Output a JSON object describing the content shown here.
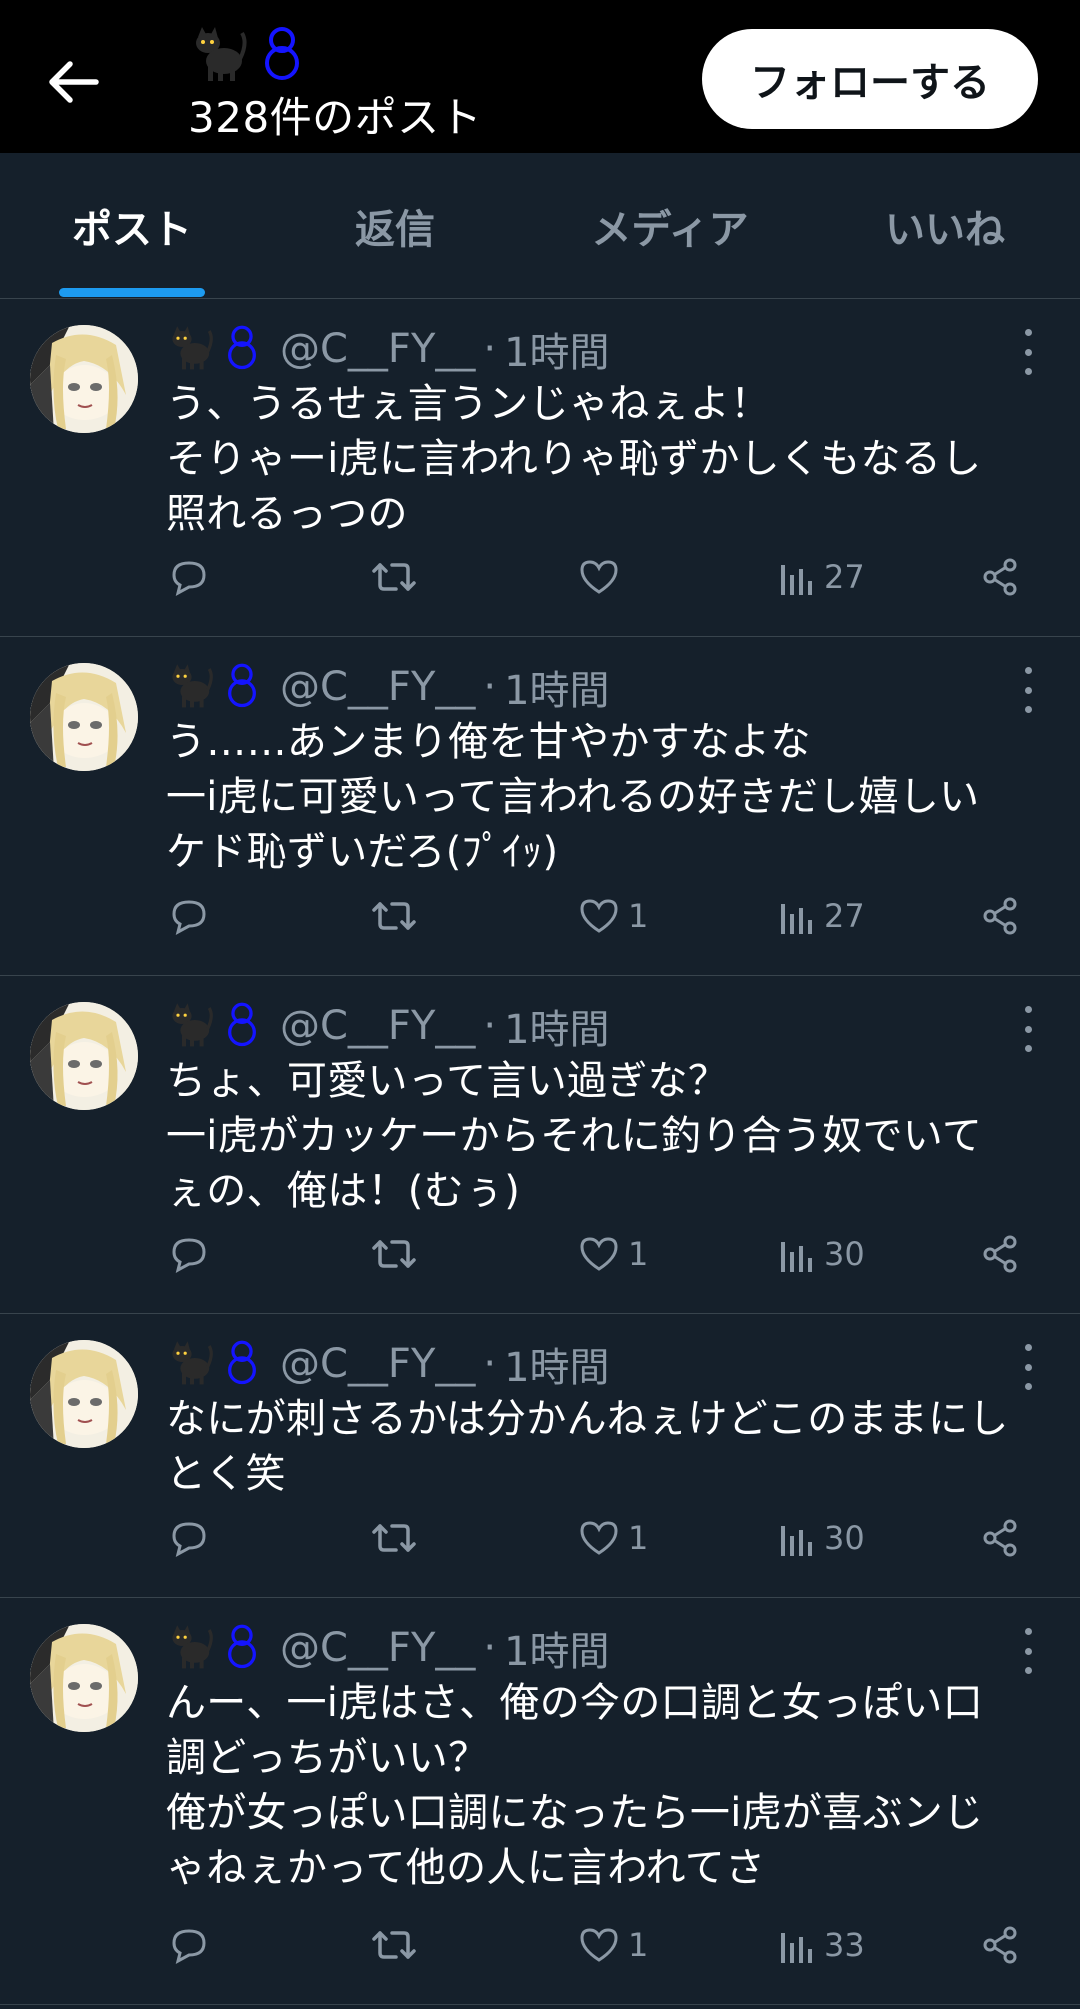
{
  "header": {
    "post_count": "328件のポスト",
    "follow_label": "フォローする",
    "emojis": [
      "black-cat-icon",
      "snowman-outline-icon"
    ]
  },
  "tabs": [
    {
      "label": "ポスト",
      "active": true
    },
    {
      "label": "返信",
      "active": false
    },
    {
      "label": "メディア",
      "active": false
    },
    {
      "label": "いいね",
      "active": false
    }
  ],
  "posts": [
    {
      "handle": "@C__FY__",
      "time": "1時間",
      "text": "う、うるせぇ言うンじゃねぇよ！\nそりゃーi虎に言われりゃ恥ずかしくもなるし\n照れるっつの",
      "likes": "",
      "views": "27"
    },
    {
      "handle": "@C__FY__",
      "time": "1時間",
      "text": "う……あンまり俺を甘やかすなよな\n一i虎に可愛いって言われるの好きだし嬉しい\nケド恥ずいだろ(ﾌﾟｲｯ)",
      "likes": "1",
      "views": "27"
    },
    {
      "handle": "@C__FY__",
      "time": "1時間",
      "text": "ちょ、可愛いって言い過ぎな？\n一i虎がカッケーからそれに釣り合う奴でいて\nぇの、俺は！(むぅ)",
      "likes": "1",
      "views": "30"
    },
    {
      "handle": "@C__FY__",
      "time": "1時間",
      "text": "なにが刺さるかは分かんねぇけどこのままにし\nとく笑",
      "likes": "1",
      "views": "30"
    },
    {
      "handle": "@C__FY__",
      "time": "1時間",
      "text": "んー、一i虎はさ、俺の今の口調と女っぽい口\n調どっちがいい？\n俺が女っぽい口調になったら一i虎が喜ぶンじ\nゃねぇかって他の人に言われてさ",
      "likes": "1",
      "views": "33"
    }
  ],
  "colors": {
    "background": "#15202b",
    "header_bg": "#000000",
    "accent": "#1d9bf0",
    "muted": "#8b98a5",
    "divider": "#38444d"
  }
}
